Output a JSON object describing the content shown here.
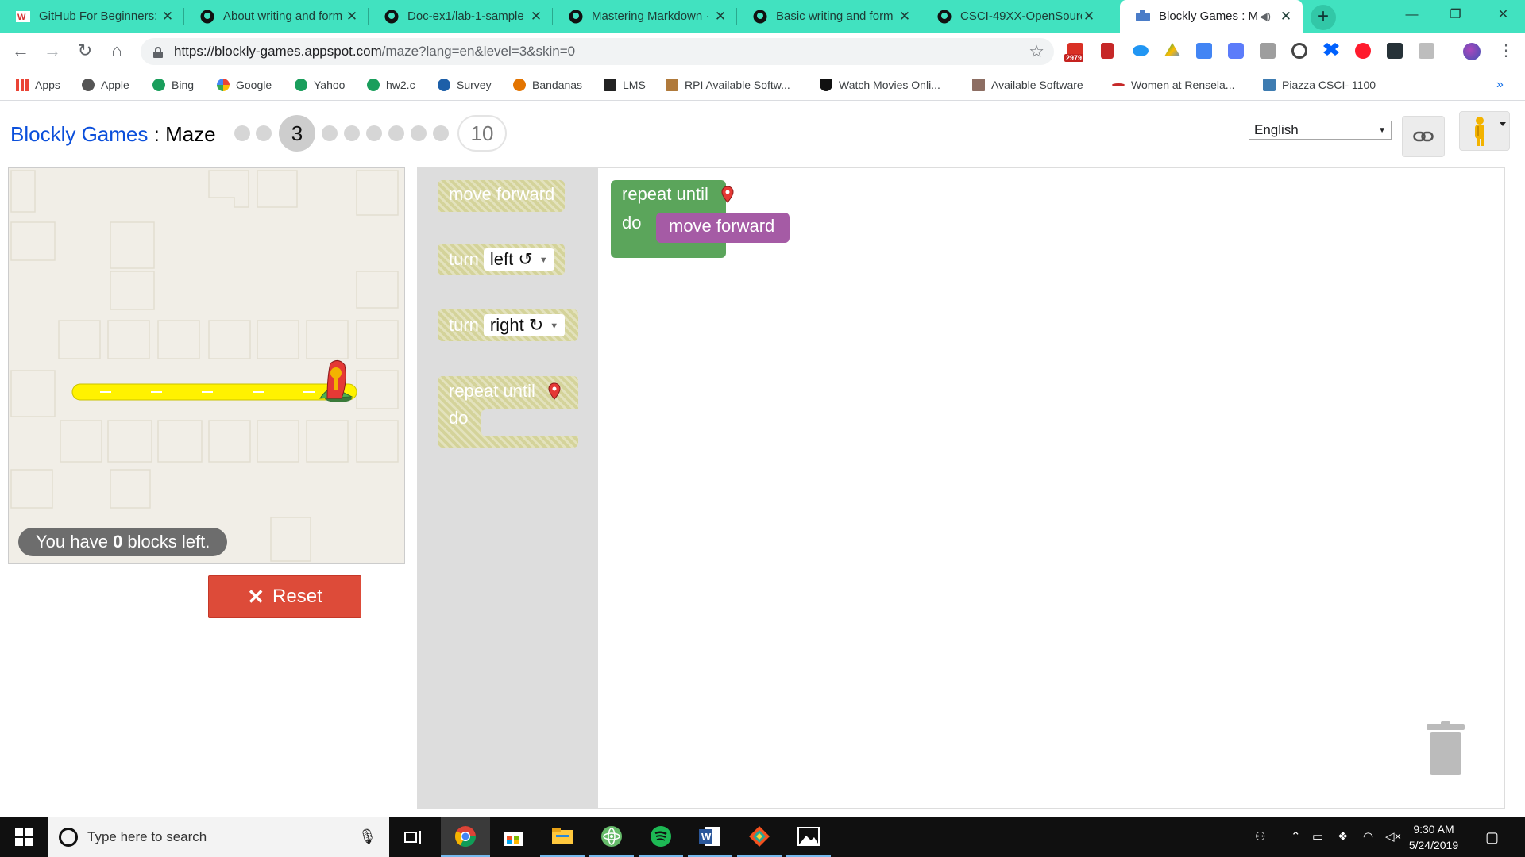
{
  "browser": {
    "tabs": [
      {
        "title": "GitHub For Beginners:",
        "favicon": "w-logo-icon"
      },
      {
        "title": "About writing and form",
        "favicon": "github-icon"
      },
      {
        "title": "Doc-ex1/lab-1-sample",
        "favicon": "github-icon"
      },
      {
        "title": "Mastering Markdown ·",
        "favicon": "github-icon"
      },
      {
        "title": "Basic writing and form",
        "favicon": "github-icon"
      },
      {
        "title": "CSCI-49XX-OpenSourc",
        "favicon": "github-icon"
      },
      {
        "title": "Blockly Games : M",
        "favicon": "blockly-icon",
        "active": true
      }
    ],
    "url_host": "https://blockly-games.appspot.com",
    "url_rest": "/maze?lang=en&level=3&skin=0",
    "gmail_badge": "2979",
    "accent": "#41e2c0"
  },
  "bookmarks": [
    {
      "label": "Apps",
      "icon": "apps-grid-icon",
      "color": "#ea4335"
    },
    {
      "label": "Apple",
      "icon": "apple-icon",
      "color": "#555555"
    },
    {
      "label": "Bing",
      "icon": "globe-icon",
      "color": "#1a9e5c"
    },
    {
      "label": "Google",
      "icon": "google-icon",
      "color": "#4285f4"
    },
    {
      "label": "Yahoo",
      "icon": "globe-icon",
      "color": "#1a9e5c"
    },
    {
      "label": "hw2.c",
      "icon": "globe-icon",
      "color": "#1a9e5c"
    },
    {
      "label": "Survey",
      "icon": "survey-icon",
      "color": "#1d5fa8"
    },
    {
      "label": "Bandanas",
      "icon": "bandanas-icon",
      "color": "#e37400"
    },
    {
      "label": "LMS",
      "icon": "lms-icon",
      "color": "#222222"
    },
    {
      "label": "RPI Available Softw...",
      "icon": "rpi-icon",
      "color": "#b07a3b"
    },
    {
      "label": "Watch Movies Onli...",
      "icon": "shield-icon",
      "color": "#111111"
    },
    {
      "label": "Available Software",
      "icon": "page-icon",
      "color": "#8d6e63"
    },
    {
      "label": "Women at Rensela...",
      "icon": "wave-icon",
      "color": "#c62828"
    },
    {
      "label": "Piazza CSCI- 1100",
      "icon": "piazza-icon",
      "color": "#3e7cb1"
    }
  ],
  "game": {
    "brand": "Blockly Games",
    "separator": " : ",
    "name": "Maze",
    "current_level": "3",
    "last_level": "10",
    "language": "English",
    "blocks_left_prefix": "You have ",
    "blocks_left_count": "0",
    "blocks_left_suffix": " blocks left.",
    "reset_label": "Reset"
  },
  "toolbox": {
    "move_forward": "move forward",
    "turn": "turn",
    "left": "left ↺",
    "right": "right ↻",
    "repeat_until": "repeat until",
    "do": "do"
  },
  "workspace": {
    "repeat_until": "repeat until",
    "do": "do",
    "move_forward": "move forward"
  },
  "colors": {
    "link_blue": "#0b4fdb",
    "loop_green": "#5ba55b",
    "move_purple": "#a55ba5",
    "reset_red": "#dd4b39",
    "path_yellow": "#fff200"
  },
  "taskbar": {
    "search_placeholder": "Type here to search",
    "time": "9:30 AM",
    "date": "5/24/2019"
  }
}
